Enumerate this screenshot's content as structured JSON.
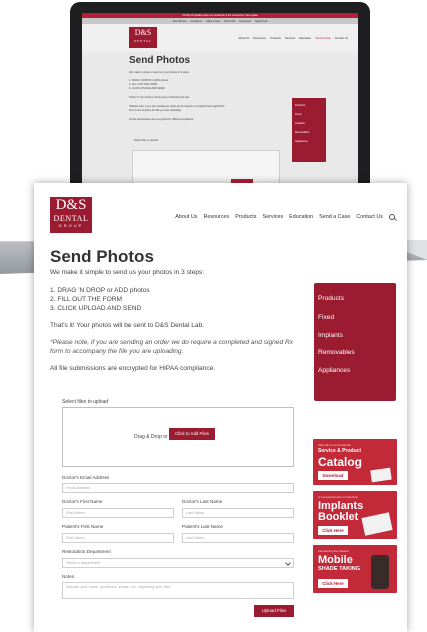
{
  "laptop": {
    "banner": "COVID-19 Updates about our dental lab in the coronavirus. See update",
    "utility_links": [
      "Send Photos",
      "Contact Us",
      "Make a Case",
      "Book Now",
      "Dental Lab",
      "Search Lab"
    ],
    "logo_main": "D&S",
    "logo_sub": "DENTAL",
    "nav": [
      "About Us",
      "Resources",
      "Products",
      "Services",
      "Education",
      "Send a Case",
      "Contact Us"
    ],
    "title": "Send Photos",
    "intro": "We make it simple to send us your photos in 3 steps:",
    "steps": [
      "1. DRAG 'N DROP or ADD photos",
      "2. FILL OUT THE FORM",
      "3. CLICK UPLOAD AND SEND"
    ],
    "done": "That's it! Your photos will be sent to D&S Dental Lab.",
    "note1": "*Please note, if you are sending an order we do require a completed and signed Rx",
    "note2": "form to accompany the file you are uploading.",
    "hipaa": "All file submissions are encrypted for HIPAA compliance.",
    "upload_label": "Select files to upload",
    "side_menu": [
      "Products",
      "Fixed",
      "Implants",
      "Removables",
      "Appliances"
    ]
  },
  "header": {
    "logo_main": "D&S",
    "logo_sub": "DENTAL",
    "logo_tag": "GROUP",
    "nav": [
      "About Us",
      "Resources",
      "Products",
      "Services",
      "Education",
      "Send a Case",
      "Contact Us"
    ]
  },
  "main": {
    "title": "Send Photos",
    "intro": "We make it simple to send us your photos in 3 steps:",
    "steps": [
      "1. DRAG 'N DROP or ADD photos",
      "2. FILL OUT THE FORM",
      "3. CLICK UPLOAD AND SEND"
    ],
    "done": "That's it! Your photos will be sent to D&S Dental Lab.",
    "note_line1": "*Please note, if you are sending an order we do require a completed and signed Rx",
    "note_line2": "form to accompany the file you are uploading.",
    "hipaa": "All file submissions are encrypted for HIPAA compliance."
  },
  "form": {
    "upload_label": "Select files to upload",
    "drop_text": "Drag & Drop or",
    "add_button": "Click to Add Files",
    "email_label": "Doctor's Email Address",
    "email_placeholder": "Email Address",
    "dr_first_label": "Doctor's First Name",
    "dr_first_placeholder": "First Name",
    "dr_last_label": "Doctor's Last Name",
    "dr_last_placeholder": "Last Name",
    "pt_first_label": "Patient's First Name",
    "pt_first_placeholder": "First Name",
    "pt_last_label": "Patient's Last Name",
    "pt_last_placeholder": "Last Name",
    "dept_label": "Restoration Department",
    "dept_value": "Select a department",
    "notes_label": "Notes",
    "notes_placeholder": "Indicate your notes, questions, shade, etc. regarding your files",
    "submit": "Upload Files"
  },
  "sidebar": {
    "menu": [
      "Products",
      "Fixed",
      "Implants",
      "Removables",
      "Appliances"
    ]
  },
  "ads": {
    "catalog": {
      "small1": "View all of our dental lab",
      "small2": "Service & Product",
      "big": "Catalog",
      "button": "Download"
    },
    "implants": {
      "small1": "A Comprehensive Introduction",
      "big1": "Implants",
      "big2": "Booklet",
      "button": "Click Here"
    },
    "mobile": {
      "small1": "Introducing the Newest",
      "big": "Mobile",
      "sub": "SHADE TAKING",
      "button": "Click Here"
    }
  },
  "colors": {
    "brand": "#9b1b30",
    "accent": "#c22a3a"
  }
}
